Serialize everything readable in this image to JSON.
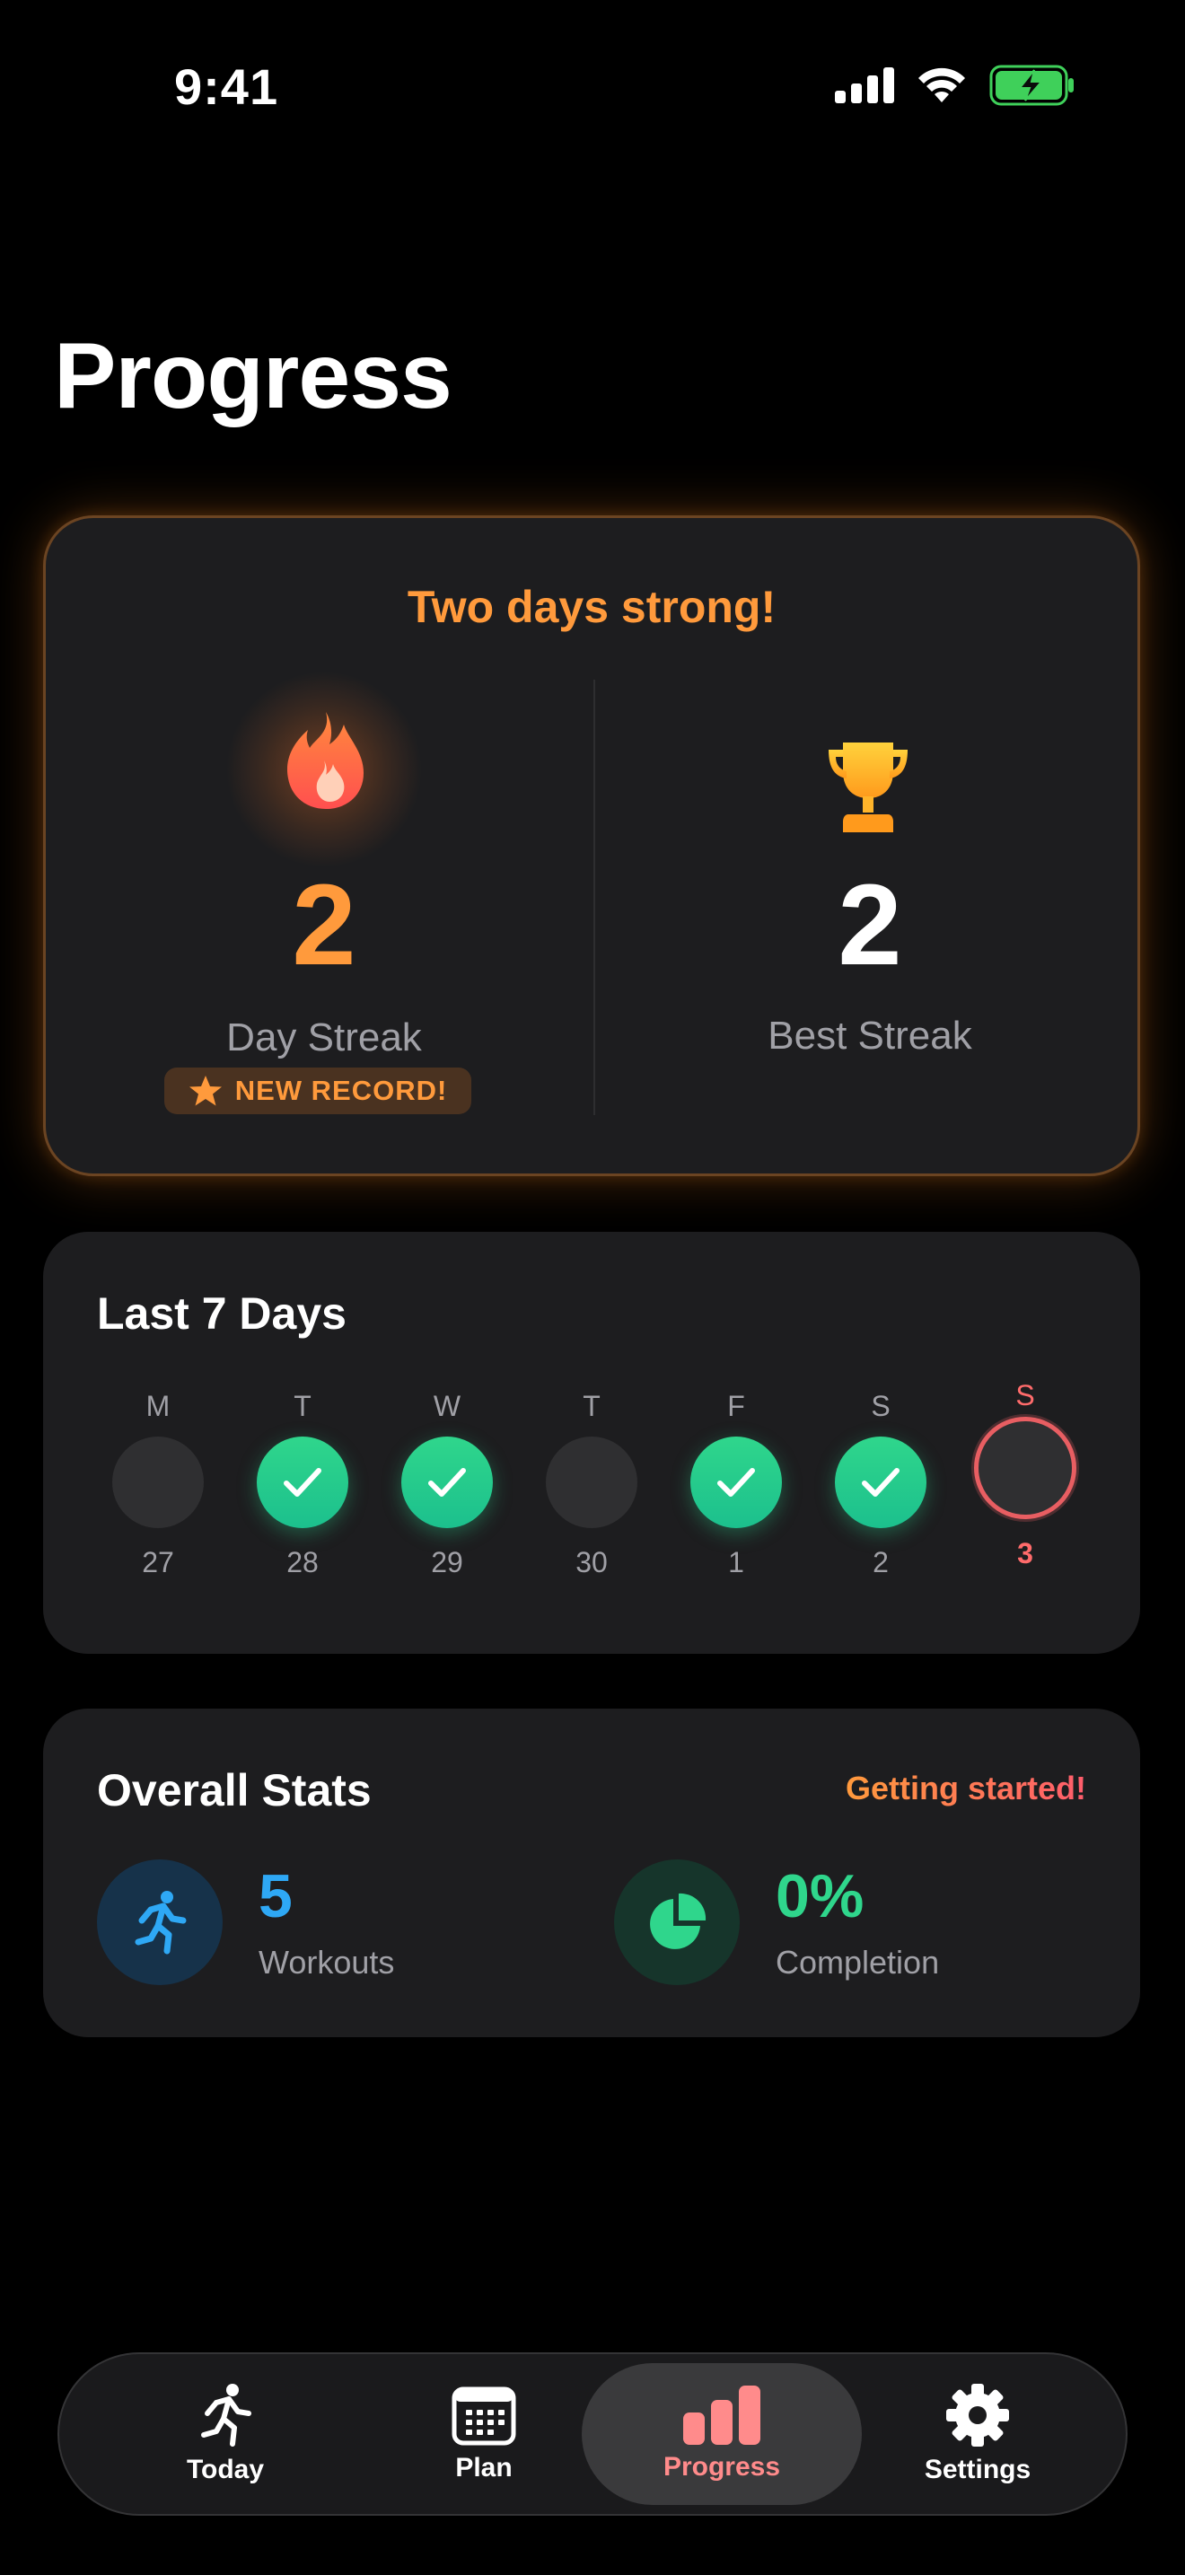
{
  "status_bar": {
    "time": "9:41"
  },
  "page": {
    "title": "Progress"
  },
  "streak": {
    "headline": "Two days strong!",
    "day_streak_value": "2",
    "day_streak_label": "Day Streak",
    "badge_text": "NEW RECORD!",
    "best_streak_value": "2",
    "best_streak_label": "Best Streak"
  },
  "last7": {
    "title": "Last 7 Days",
    "days": [
      {
        "letter": "M",
        "num": "27",
        "done": false
      },
      {
        "letter": "T",
        "num": "28",
        "done": true
      },
      {
        "letter": "W",
        "num": "29",
        "done": true
      },
      {
        "letter": "T",
        "num": "30",
        "done": false
      },
      {
        "letter": "F",
        "num": "1",
        "done": true
      },
      {
        "letter": "S",
        "num": "2",
        "done": true
      },
      {
        "letter": "S",
        "num": "3",
        "done": false,
        "today": true
      }
    ]
  },
  "overall": {
    "title": "Overall Stats",
    "subtitle": "Getting started!",
    "workouts_value": "5",
    "workouts_label": "Workouts",
    "completion_value": "0%",
    "completion_label": "Completion"
  },
  "tabs": [
    {
      "label": "Today",
      "icon": "running-figure-icon"
    },
    {
      "label": "Plan",
      "icon": "calendar-icon"
    },
    {
      "label": "Progress",
      "icon": "bar-chart-icon",
      "active": true
    },
    {
      "label": "Settings",
      "icon": "gear-icon"
    }
  ],
  "colors": {
    "accent_orange": "#ff9a3c",
    "success_green": "#2fd68c",
    "today_red": "#e85e62",
    "workouts_blue": "#2ea8f5",
    "active_tab": "#ff8b8b"
  }
}
